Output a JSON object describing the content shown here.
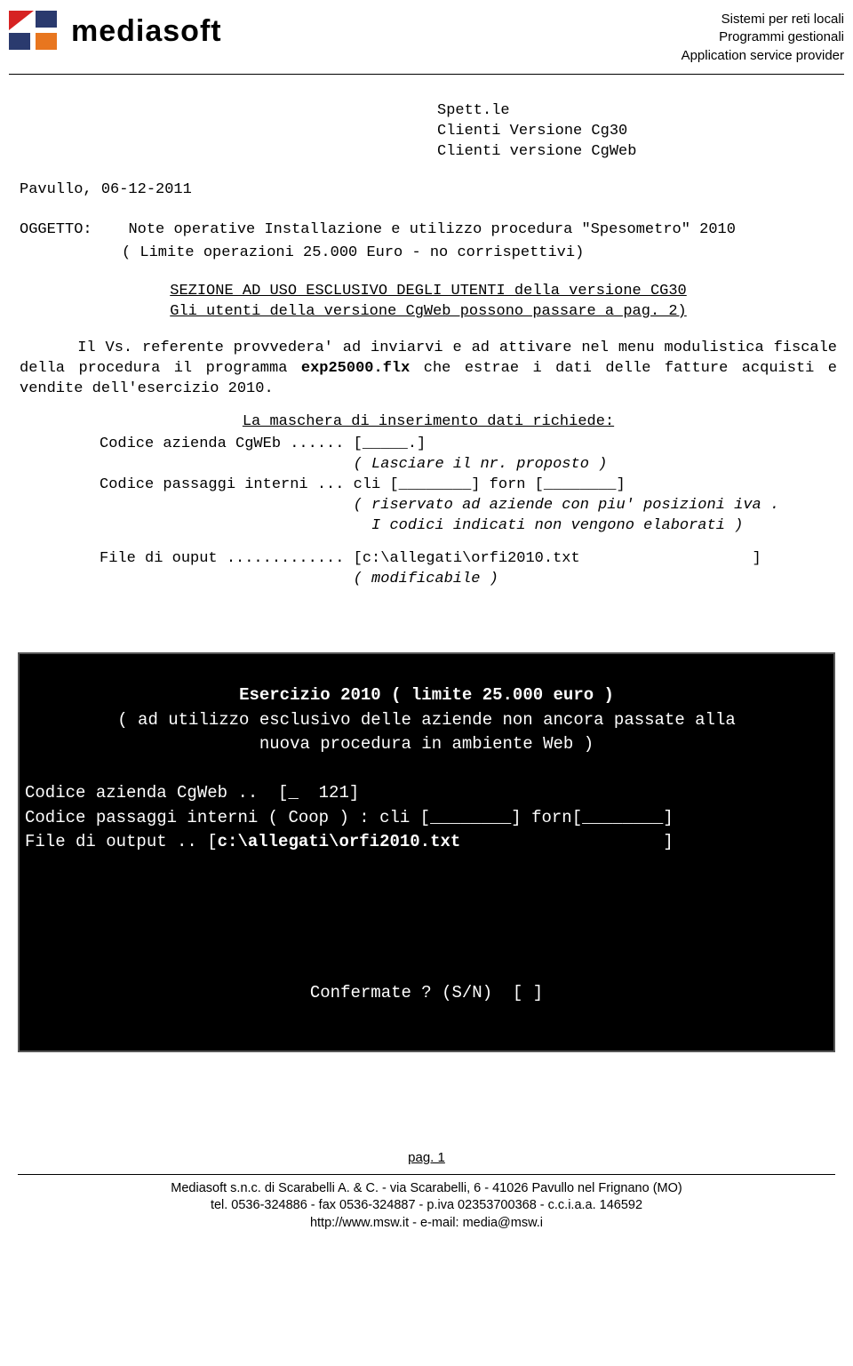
{
  "header": {
    "brand": "mediasoft",
    "meta_line1": "Sistemi per reti locali",
    "meta_line2": "Programmi gestionali",
    "meta_line3": "Application service provider"
  },
  "address": {
    "line1": "Spett.le",
    "line2": "Clienti Versione Cg30",
    "line3": "Clienti versione CgWeb"
  },
  "date_location": "Pavullo, 06-12-2011",
  "subject_label": "OGGETTO:",
  "subject_line1": "Note operative Installazione e utilizzo procedura \"Spesometro\" 2010",
  "subject_line2": "( Limite operazioni 25.000 Euro - no corrispettivi)",
  "section_note1": "SEZIONE AD USO ESCLUSIVO DEGLI UTENTI della versione CG30",
  "section_note2": "Gli utenti della versione CgWeb possono passare a  pag. 2)",
  "paragraph1": "Il Vs. referente provvedera' ad inviarvi e ad attivare nel menu modulistica fiscale della procedura il programma exp25000.flx che estrae i dati delle fatture acquisti e vendite dell'esercizio 2010.",
  "mask_title": "La maschera di inserimento dati richiede:",
  "form_line1": "Codice azienda CgWEb ...... [_____.]",
  "form_line1b": "                            ( Lasciare il nr. proposto )",
  "form_line2": "Codice passaggi interni ... cli [________] forn [________]",
  "form_line2b": "                            ( riservato ad aziende con piu' posizioni iva .",
  "form_line2c": "                              I codici indicati non vengono elaborati )",
  "form_line3": "File di ouput ............. [c:\\allegati\\orfi2010.txt                   ]",
  "form_line3b": "                            ( modificabile )",
  "terminal": {
    "line1": "Esercizio 2010 ( limite 25.000 euro )",
    "line2": "( ad utilizzo esclusivo delle aziende non ancora passate alla",
    "line3": "nuova procedura in ambiente Web )",
    "line4": "Codice azienda CgWeb ..  [_  121]",
    "line5": "Codice passaggi interni ( Coop ) : cli [________] forn[________]",
    "line6": "File di output .. [c:\\allegati\\orfi2010.txt                    ]",
    "confirm": "Confermate ? (S/N)  [ ]"
  },
  "page_number": "pag. 1",
  "footer": {
    "line1": "Mediasoft s.n.c. di Scarabelli A. & C. - via Scarabelli, 6 - 41026 Pavullo nel Frignano (MO)",
    "line2": "tel. 0536-324886 - fax 0536-324887 - p.iva 02353700368 - c.c.i.a.a. 146592",
    "line3": "http://www.msw.it - e-mail: media@msw.i"
  }
}
